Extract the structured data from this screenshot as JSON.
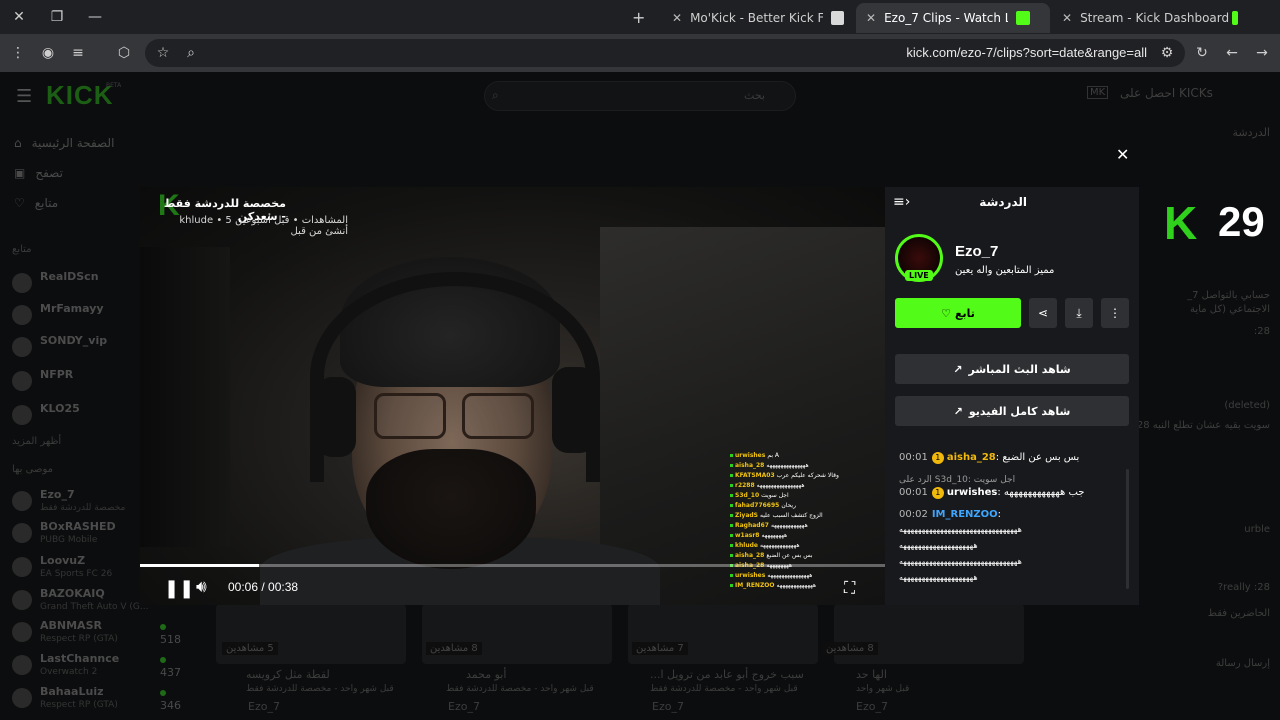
{
  "browser": {
    "tabs": [
      {
        "label": "Mo'Kick - Better Kick For Everyone",
        "active": false
      },
      {
        "label": "Ezo_7 Clips - Watch Live on Kick",
        "active": true
      },
      {
        "label": "Stream - Kick Dashboard",
        "active": false
      }
    ],
    "url": "kick.com/ezo-7/clips?sort=date&range=all"
  },
  "header": {
    "logo": "KICK",
    "beta": "BETA",
    "search_placeholder": "بحث",
    "get_kicks": "احصل على KICKs"
  },
  "sidebar": {
    "nav": [
      {
        "label": "الصفحة الرئيسية",
        "icon": "home-icon"
      },
      {
        "label": "تصفح",
        "icon": "browse-icon"
      },
      {
        "label": "متابع",
        "icon": "heart-icon"
      }
    ],
    "following_heading": "متابع",
    "following": [
      "RealDScn",
      "MrFamayy",
      "SONDY_vip",
      "NFPR",
      "KLO25"
    ],
    "show_more": "أظهر المزيد",
    "recommended_heading": "موصى بها",
    "channels": [
      {
        "name": "Ezo_7",
        "sub": "مخصصة للدردشة فقط",
        "viewers": ""
      },
      {
        "name": "BOxRASHED",
        "sub": "PUBG Mobile",
        "viewers": ""
      },
      {
        "name": "LoovuZ",
        "sub": "EA Sports FC 26",
        "viewers": ""
      },
      {
        "name": "BAZOKAIQ",
        "sub": "Grand Theft Auto V (G...",
        "viewers": ""
      },
      {
        "name": "ABNMASR",
        "sub": "Respect RP (GTA)",
        "viewers": "518"
      },
      {
        "name": "LastChannce",
        "sub": "Overwatch 2",
        "viewers": "437"
      },
      {
        "name": "BahaaLuiz",
        "sub": "Respect RP (GTA)",
        "viewers": "346"
      }
    ]
  },
  "bg_cards": [
    {
      "viewers": "5 مشاهدين",
      "title": "لقطة مثل كرويسه",
      "meta": "قبل شهر واحد - مخصصة للدردشة فقط",
      "user": "Ezo_7"
    },
    {
      "viewers": "8 مشاهدين",
      "title": "أبو محمد",
      "meta": "قبل شهر واحد - مخصصة للدردشة فقط",
      "user": "Ezo_7"
    },
    {
      "viewers": "7 مشاهدين",
      "title": "سبب خروج أبو عابد من ترويل ا...",
      "meta": "قبل شهر واحد - مخصصة للدردشة فقط",
      "user": "Ezo_7"
    },
    {
      "viewers": "8 مشاهدين",
      "title": "الها حد",
      "meta": "قبل شهر واحد",
      "user": "Ezo_7"
    }
  ],
  "right_chat": {
    "title": "الدردشة",
    "lines": [
      "حسابي بالتواصل 7_",
      "الاجتماعي (كل ماية",
      "28:",
      "(deleted)",
      "سويت بقيه عشان تطلع النبه 28:",
      "urble",
      "28: really?",
      "الحاضرين فقط",
      "إرسال رسالة"
    ]
  },
  "modal": {
    "close_icon": "close-icon",
    "video": {
      "title": "مخصصة للدردشة فقط - سعدكن",
      "meta": "المشاهدات • قبل أسبوعين 5 • khlude أنشئ من قبل",
      "time": "00:06 / 00:38",
      "progress_fraction": 0.16,
      "overlay_chat": [
        {
          "user": "urwishes",
          "text": "بم A"
        },
        {
          "user": "aisha_28",
          "text": "ههههههههههههههه"
        },
        {
          "user": "KFATSMA03",
          "text": "وقالا شحركه عليكم عرب"
        },
        {
          "user": "r2288",
          "text": "ههههههههههههههههه"
        },
        {
          "user": "S3d_10",
          "text": "اجل سويت"
        },
        {
          "user": "fahad776695",
          "text": "ريحان"
        },
        {
          "user": "ZiyadS",
          "text": "الزوج كتشف السبب عليه"
        },
        {
          "user": "Raghad67",
          "text": "ههههههههههههه"
        },
        {
          "user": "w1asr8",
          "text": "ههههههههه"
        },
        {
          "user": "khlude",
          "text": "هههههههههههههه"
        },
        {
          "user": "aisha_28",
          "text": "بس بس عن الضبع"
        },
        {
          "user": "aisha_28",
          "text": "ههههههههه"
        },
        {
          "user": "urwishes",
          "text": "هههههههههههههههه"
        },
        {
          "user": "IM_RENZOO",
          "text": "هههههههههههههه"
        }
      ]
    },
    "panel": {
      "title": "الدردشة",
      "streamer": "Ezo_7",
      "live": "LIVE",
      "tagline": "مميز المتابعين واله يعين",
      "follow": "تابع",
      "watch_live": "شاهد البث المباشر",
      "watch_full": "شاهد كامل الفيديو",
      "messages": [
        {
          "time": "00:01",
          "user": "aisha_28",
          "badge": "1",
          "text": "بس بس عن الضبع"
        },
        {
          "reply": "الرد على S3d_10: اجل سويت"
        },
        {
          "time": "00:01",
          "user": "urwishes",
          "badge": "1",
          "text": "جب ههههههههههههه"
        },
        {
          "time": "00:02",
          "user": "IM_RENZOO",
          "badge": "",
          "text": ""
        },
        {
          "text": "ههههههههههههههههههههههههههههههههه"
        },
        {
          "text": "ههههههههههههههههههههه"
        },
        {
          "text": "ههههههههههههههههههههههههههههههههه"
        },
        {
          "text": "ههههههههههههههههههههه"
        }
      ]
    }
  },
  "overlay_counter": "29",
  "overlay_logo": "K",
  "colors": {
    "kick_green": "#53fc18",
    "panel_bg": "#18191c",
    "button_bg": "#2f3033"
  }
}
